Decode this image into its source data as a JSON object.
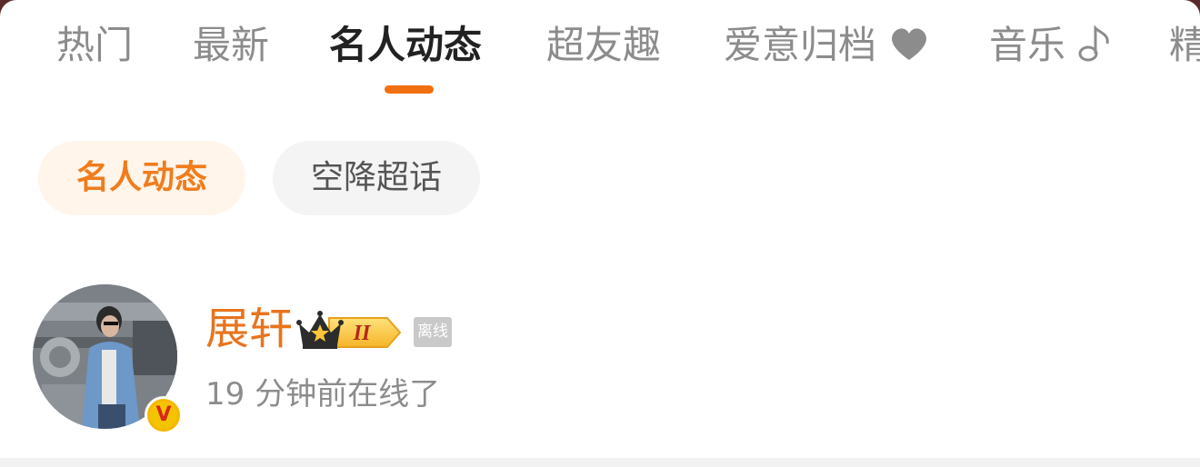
{
  "tabs": [
    {
      "label": "热门"
    },
    {
      "label": "最新"
    },
    {
      "label": "名人动态"
    },
    {
      "label": "超友趣"
    },
    {
      "label": "爱意归档",
      "icon": "heart-icon"
    },
    {
      "label": "音乐",
      "icon": "music-note-icon"
    },
    {
      "label": "精"
    }
  ],
  "active_tab": "名人动态",
  "chips": [
    {
      "label": "名人动态"
    },
    {
      "label": "空降超话"
    }
  ],
  "active_chip": "名人动态",
  "user": {
    "name": "展轩",
    "level_badge": "II",
    "status": "离线",
    "last_online": "19 分钟前在线了",
    "verified_badge": "V"
  },
  "colors": {
    "accent": "#f26f0f",
    "chip_active_bg": "#fff5eb",
    "chip_active_text": "#f07c1c",
    "username": "#e8741e",
    "muted_text": "#8c8c8c"
  }
}
